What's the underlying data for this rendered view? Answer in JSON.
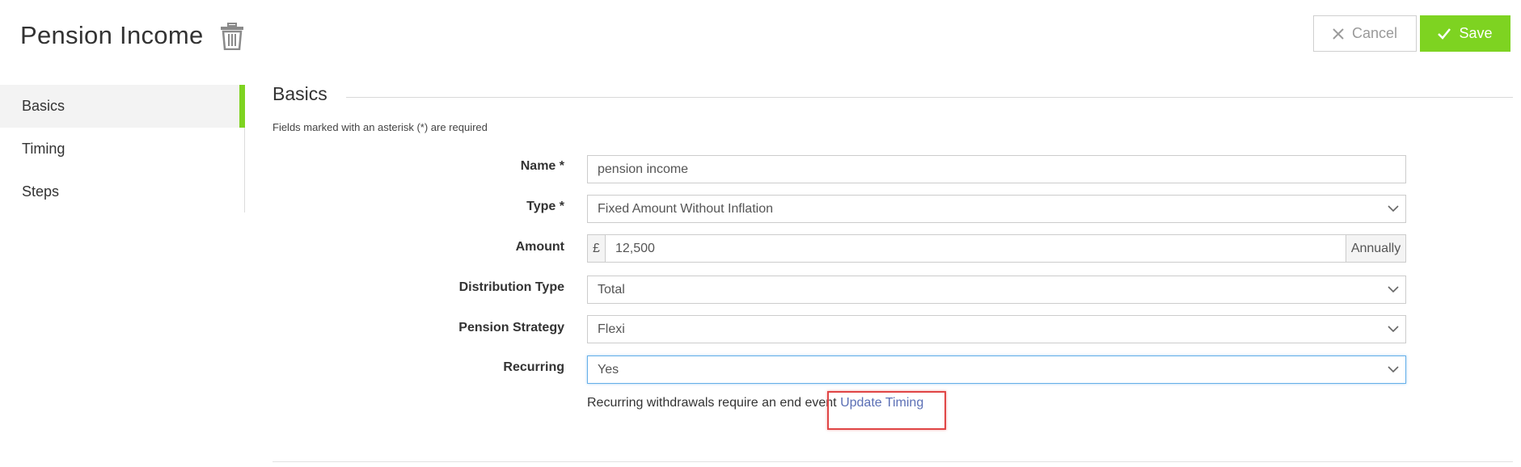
{
  "header": {
    "title": "Pension Income",
    "cancel_label": "Cancel",
    "save_label": "Save",
    "icons": {
      "delete": "trash-icon",
      "cancel": "close-icon",
      "save": "check-icon"
    }
  },
  "colors": {
    "accent": "#7ed321",
    "link": "#5b6fb5",
    "highlight": "#e04545"
  },
  "sidebar": {
    "items": [
      {
        "label": "Basics",
        "active": true
      },
      {
        "label": "Timing",
        "active": false
      },
      {
        "label": "Steps",
        "active": false
      }
    ]
  },
  "section": {
    "title": "Basics",
    "required_note": "Fields marked with an asterisk (*) are required"
  },
  "form": {
    "name": {
      "label": "Name *",
      "value": "pension income"
    },
    "type": {
      "label": "Type *",
      "value": "Fixed Amount Without Inflation"
    },
    "amount": {
      "label": "Amount",
      "prefix": "£",
      "value": "12,500",
      "suffix": "Annually"
    },
    "distribution_type": {
      "label": "Distribution Type",
      "value": "Total"
    },
    "pension_strategy": {
      "label": "Pension Strategy",
      "value": "Flexi"
    },
    "recurring": {
      "label": "Recurring",
      "value": "Yes"
    }
  },
  "hint": {
    "text": "Recurring withdrawals require an end event",
    "link": "Update Timing"
  }
}
